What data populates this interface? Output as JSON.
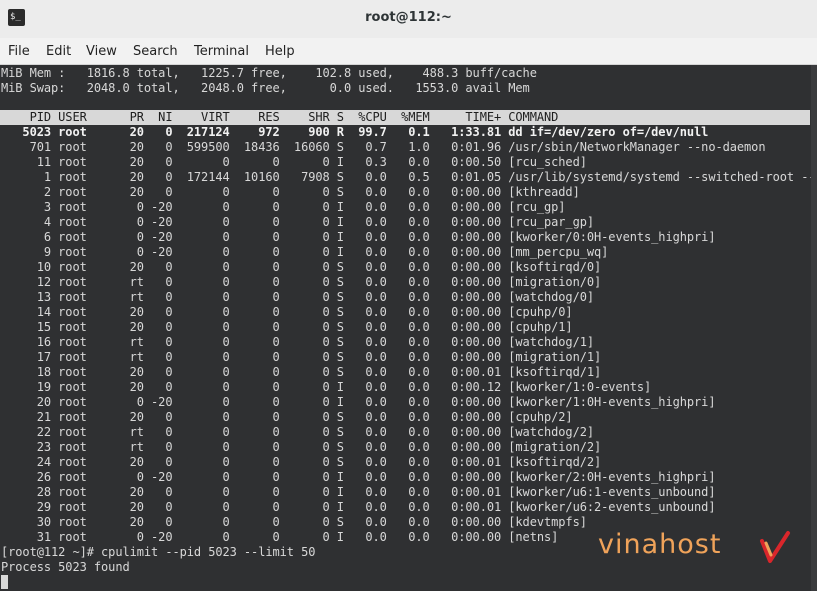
{
  "window": {
    "title": "root@112:~"
  },
  "menu": [
    "File",
    "Edit",
    "View",
    "Search",
    "Terminal",
    "Help"
  ],
  "summary": {
    "mem": "MiB Mem :   1816.8 total,   1225.7 free,    102.8 used,    488.3 buff/cache",
    "swap": "MiB Swap:   2048.0 total,   2048.0 free,      0.0 used.   1553.0 avail Mem"
  },
  "table": {
    "header": "    PID USER      PR  NI    VIRT    RES    SHR S  %CPU  %MEM     TIME+ COMMAND",
    "rows": [
      "   5023 root      20   0  217124    972    900 R  99.7   0.1   1:33.81 dd if=/dev/zero of=/dev/null",
      "    701 root      20   0  599500  18436  16060 S   0.7   1.0   0:01.96 /usr/sbin/NetworkManager --no-daemon",
      "     11 root      20   0       0      0      0 I   0.3   0.0   0:00.50 [rcu_sched]",
      "      1 root      20   0  172144  10160   7908 S   0.0   0.5   0:01.05 /usr/lib/systemd/systemd --switched-root --+",
      "      2 root      20   0       0      0      0 S   0.0   0.0   0:00.00 [kthreadd]",
      "      3 root       0 -20       0      0      0 I   0.0   0.0   0:00.00 [rcu_gp]",
      "      4 root       0 -20       0      0      0 I   0.0   0.0   0:00.00 [rcu_par_gp]",
      "      6 root       0 -20       0      0      0 I   0.0   0.0   0:00.00 [kworker/0:0H-events_highpri]",
      "      9 root       0 -20       0      0      0 I   0.0   0.0   0:00.00 [mm_percpu_wq]",
      "     10 root      20   0       0      0      0 S   0.0   0.0   0:00.00 [ksoftirqd/0]",
      "     12 root      rt   0       0      0      0 S   0.0   0.0   0:00.00 [migration/0]",
      "     13 root      rt   0       0      0      0 S   0.0   0.0   0:00.00 [watchdog/0]",
      "     14 root      20   0       0      0      0 S   0.0   0.0   0:00.00 [cpuhp/0]",
      "     15 root      20   0       0      0      0 S   0.0   0.0   0:00.00 [cpuhp/1]",
      "     16 root      rt   0       0      0      0 S   0.0   0.0   0:00.00 [watchdog/1]",
      "     17 root      rt   0       0      0      0 S   0.0   0.0   0:00.00 [migration/1]",
      "     18 root      20   0       0      0      0 S   0.0   0.0   0:00.01 [ksoftirqd/1]",
      "     19 root      20   0       0      0      0 I   0.0   0.0   0:00.12 [kworker/1:0-events]",
      "     20 root       0 -20       0      0      0 I   0.0   0.0   0:00.00 [kworker/1:0H-events_highpri]",
      "     21 root      20   0       0      0      0 S   0.0   0.0   0:00.00 [cpuhp/2]",
      "     22 root      rt   0       0      0      0 S   0.0   0.0   0:00.00 [watchdog/2]",
      "     23 root      rt   0       0      0      0 S   0.0   0.0   0:00.00 [migration/2]",
      "     24 root      20   0       0      0      0 S   0.0   0.0   0:00.01 [ksoftirqd/2]",
      "     26 root       0 -20       0      0      0 I   0.0   0.0   0:00.00 [kworker/2:0H-events_highpri]",
      "     28 root      20   0       0      0      0 I   0.0   0.0   0:00.01 [kworker/u6:1-events_unbound]",
      "     29 root      20   0       0      0      0 I   0.0   0.0   0:00.01 [kworker/u6:2-events_unbound]",
      "     30 root      20   0       0      0      0 S   0.0   0.0   0:00.00 [kdevtmpfs]",
      "     31 root       0 -20       0      0      0 I   0.0   0.0   0:00.00 [netns]"
    ]
  },
  "shell": {
    "prompt_line": "[root@112 ~]# cpulimit --pid 5023 --limit 50",
    "output_line": "Process 5023 found"
  },
  "watermark": {
    "text": "vinahost",
    "accent_color": "#e8731f",
    "text_color": "#f0a35a",
    "mark_color": "#d9262b"
  }
}
